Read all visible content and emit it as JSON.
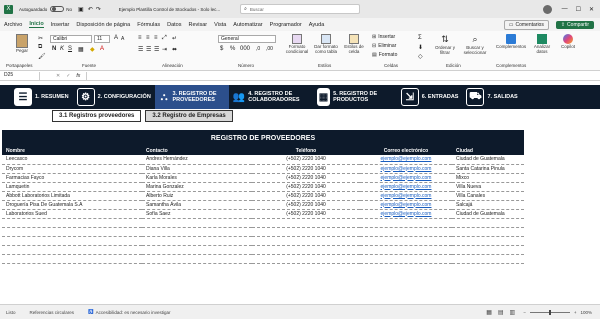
{
  "titlebar": {
    "autosave_label": "Autoguardado",
    "toggle_state": "No",
    "doc_title": "Ejemplo Plantilla Control de Stockudos - Solo lec...",
    "search_placeholder": "Buscar"
  },
  "menu": [
    "Archivo",
    "Inicio",
    "Insertar",
    "Disposición de página",
    "Fórmulas",
    "Datos",
    "Revisar",
    "Vista",
    "Automatizar",
    "Programador",
    "Ayuda"
  ],
  "menu_active": "Inicio",
  "menu_right": {
    "comments": "Comentarios",
    "share": "Compartir"
  },
  "ribbon": {
    "paste": "Pegar",
    "font_name": "Calibri",
    "font_size": "11",
    "number_format": "General",
    "groups": [
      "Portapapeles",
      "Fuente",
      "Alineación",
      "Número",
      "Estilos",
      "Celdas",
      "Edición",
      "Complementos"
    ],
    "styles": [
      "Formato condicional",
      "Dar formato como tabla",
      "Estilos de celda"
    ],
    "cells": [
      "Insertar",
      "Eliminar",
      "Formato"
    ],
    "editing": [
      "Ordenar y filtrar",
      "Buscar y seleccionar"
    ],
    "addins": [
      "Complementos",
      "Analizar datos",
      "Copilot"
    ]
  },
  "formula": {
    "cell_ref": "D25",
    "fx": "fx",
    "content": ""
  },
  "nav": [
    {
      "label": "1. RESUMEN",
      "icon": "list-icon"
    },
    {
      "label": "2. CONFIGURACIÓN",
      "icon": "gear-icon"
    },
    {
      "label": "3. REGISTRO DE PROVEEDORES",
      "icon": "suppliers-icon"
    },
    {
      "label": "4. REGISTRO DE COLABORADORES",
      "icon": "people-icon"
    },
    {
      "label": "5. REGISTRO DE PRODUCTOS",
      "icon": "box-icon"
    },
    {
      "label": "6. ENTRADAS",
      "icon": "entry-icon"
    },
    {
      "label": "7. SALIDAS",
      "icon": "truck-icon"
    }
  ],
  "subtabs": [
    "3.1 Registros proveedores",
    "3.2 Registro de Empresas"
  ],
  "table": {
    "title": "REGISTRO DE PROVEEDORES",
    "headers": [
      "Nombre",
      "Contacto",
      "Teléfono",
      "Correo electrónico",
      "Ciudad"
    ],
    "rows": [
      [
        "Leecasco",
        "Andres Hernández",
        "(+502) 2220 1040",
        "ejemplo@ejemplo.com",
        "Ciudad de Guatemala"
      ],
      [
        "Drycom",
        "Diana Villa",
        "(+502) 2220 1040",
        "ejemplo@ejemplo.com",
        "Santa Catarina Pinula"
      ],
      [
        "Farmacias Fayco",
        "Karla Morales",
        "(+502) 2220 1040",
        "ejemplo@ejemplo.com",
        "Mixco"
      ],
      [
        "Lamquetin",
        "Marina Gonzalez",
        "(+502) 2220 1040",
        "ejemplo@ejemplo.com",
        "Villa Nueva"
      ],
      [
        "Abbott Laboratorios Limitada",
        "Alberto Ruiz",
        "(+502) 2220 1040",
        "ejemplo@ejemplo.com",
        "Villa Canales"
      ],
      [
        "Droguería Pisa De Guatemala S.A",
        "Samantha Ávila",
        "(+502) 2220 1040",
        "ejemplo@ejemplo.com",
        "Salcajá"
      ],
      [
        "Laboratorios Sued",
        "Sofía Saez",
        "(+502) 2220 1040",
        "ejemplo@ejemplo.com",
        "Ciudad de Guatemala"
      ],
      [
        "",
        "",
        "",
        "",
        ""
      ],
      [
        "",
        "",
        "",
        "",
        ""
      ],
      [
        "",
        "",
        "",
        "",
        ""
      ],
      [
        "",
        "",
        "",
        "",
        ""
      ],
      [
        "",
        "",
        "",
        "",
        ""
      ]
    ]
  },
  "status": {
    "ready": "Listo",
    "circular": "Referencias circulares",
    "accessibility": "Accesibilidad: es necesario investigar",
    "zoom": "100%"
  },
  "colors": {
    "navbar": "#0d1a2b",
    "accent": "#217346",
    "active_nav": "#2c4f8c"
  }
}
